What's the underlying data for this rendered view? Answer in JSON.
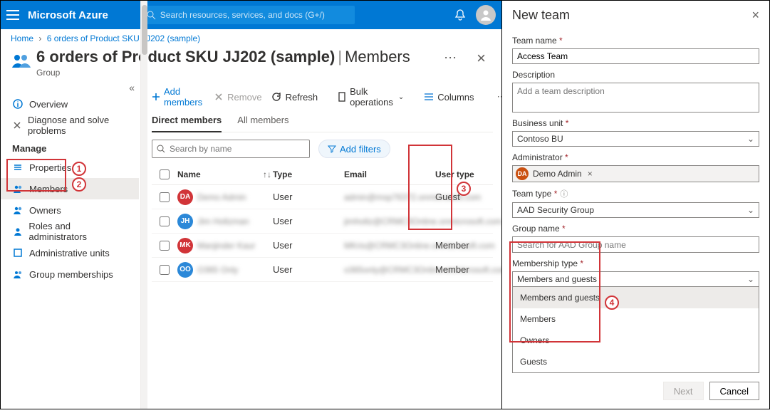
{
  "topbar": {
    "brand": "Microsoft Azure",
    "search_placeholder": "Search resources, services, and docs (G+/)"
  },
  "breadcrumb": {
    "home": "Home",
    "current": "6 orders of Product SKU JJ202 (sample)"
  },
  "blade": {
    "title_main": "6 orders of Product SKU JJ202 (sample)",
    "title_section": "Members",
    "subtitle": "Group"
  },
  "sidebar": {
    "collapse_glyph": "«",
    "items": [
      {
        "label": "Overview"
      },
      {
        "label": "Diagnose and solve problems"
      }
    ],
    "manage_header": "Manage",
    "manage_items": [
      {
        "label": "Properties"
      },
      {
        "label": "Members"
      },
      {
        "label": "Owners"
      },
      {
        "label": "Roles and administrators"
      },
      {
        "label": "Administrative units"
      },
      {
        "label": "Group memberships"
      }
    ]
  },
  "commands": {
    "add": "Add members",
    "remove": "Remove",
    "refresh": "Refresh",
    "bulk": "Bulk operations",
    "columns": "Columns"
  },
  "tabs": {
    "direct": "Direct members",
    "all": "All members"
  },
  "filters": {
    "search_placeholder": "Search by name",
    "add_filters": "Add filters"
  },
  "table": {
    "cols": {
      "name": "Name",
      "type": "Type",
      "email": "Email",
      "usertype": "User type"
    },
    "rows": [
      {
        "initials": "DA",
        "color": "#d13438",
        "name": "Demo Admin",
        "type": "User",
        "email": "admin@msp76372.onmicrosoft.com",
        "usertype": "Guest"
      },
      {
        "initials": "JH",
        "color": "#2b88d8",
        "name": "Jim Holtzman",
        "type": "User",
        "email": "jimholtz@CRMC3Online.onmicrosoft.com",
        "usertype": ""
      },
      {
        "initials": "MK",
        "color": "#d13438",
        "name": "Manjinder Kaur",
        "type": "User",
        "email": "MKris@CRMC3Online.onmicrosoft.com",
        "usertype": "Member"
      },
      {
        "initials": "OO",
        "color": "#2b88d8",
        "name": "O365 Only",
        "type": "User",
        "email": "o365only@CRMC3Online.onmicrosoft.com",
        "usertype": "Member"
      }
    ]
  },
  "annotations": {
    "n1": "1",
    "n2": "2",
    "n3": "3",
    "n4": "4"
  },
  "newteam": {
    "title": "New team",
    "labels": {
      "team_name": "Team name",
      "description": "Description",
      "business_unit": "Business unit",
      "administrator": "Administrator",
      "team_type": "Team type",
      "group_name": "Group name",
      "membership_type": "Membership type"
    },
    "values": {
      "team_name": "Access Team",
      "description_placeholder": "Add a team description",
      "business_unit": "Contoso BU",
      "administrator_initials": "DA",
      "administrator_name": "Demo Admin",
      "team_type": "AAD Security Group",
      "group_name_placeholder": "Search for AAD Group name",
      "membership_selected": "Members and guests"
    },
    "membership_options": [
      "Members and guests",
      "Members",
      "Owners",
      "Guests"
    ],
    "buttons": {
      "next": "Next",
      "cancel": "Cancel"
    }
  }
}
